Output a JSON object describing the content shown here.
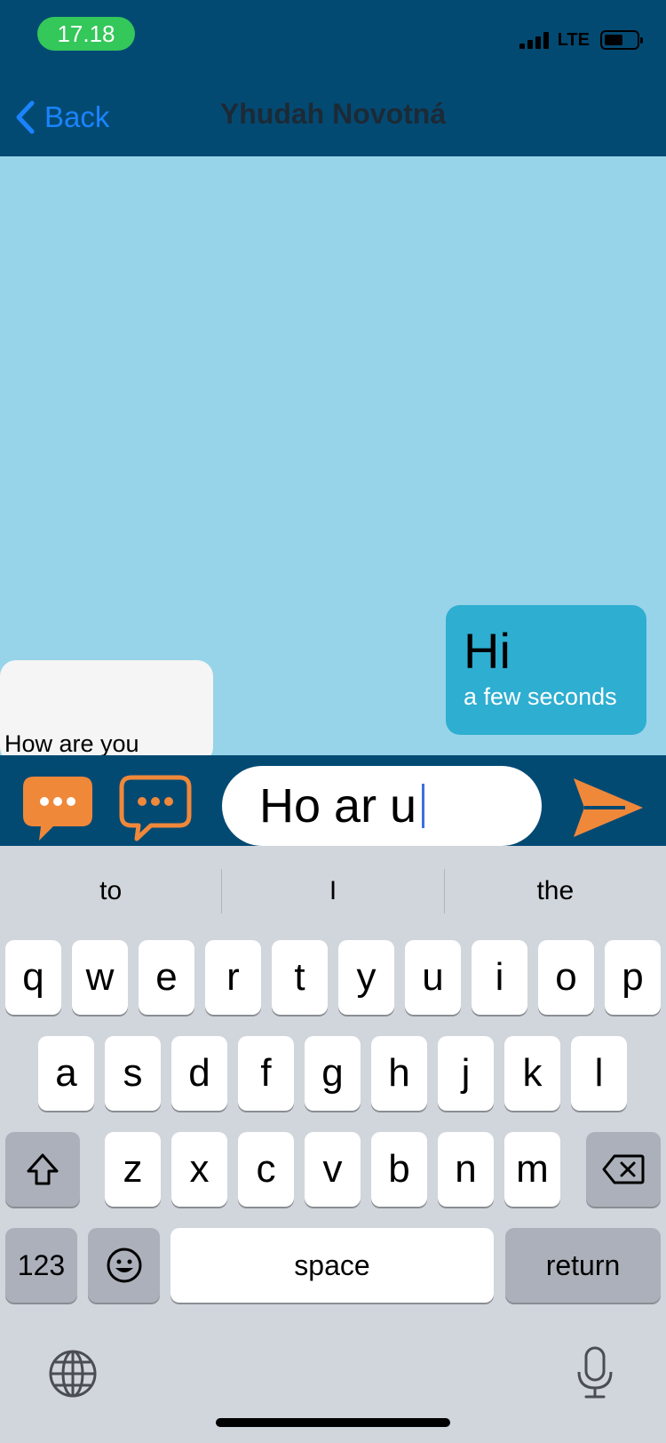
{
  "status_bar": {
    "time": "17.18",
    "network": "LTE"
  },
  "nav": {
    "back_label": "Back",
    "title": "Yhudah Novotná"
  },
  "messages": [
    {
      "direction": "outgoing",
      "text": "Hi",
      "timestamp": "a few seconds"
    },
    {
      "direction": "incoming",
      "text": "How are you"
    }
  ],
  "composer": {
    "input_value": "Ho ar u",
    "icons": [
      "chat-bubble-filled-icon",
      "chat-bubble-outline-icon",
      "send-icon"
    ]
  },
  "keyboard": {
    "suggestions": [
      "to",
      "I",
      "the"
    ],
    "row1": [
      "q",
      "w",
      "e",
      "r",
      "t",
      "y",
      "u",
      "i",
      "o",
      "p"
    ],
    "row2": [
      "a",
      "s",
      "d",
      "f",
      "g",
      "h",
      "j",
      "k",
      "l"
    ],
    "row3": [
      "z",
      "x",
      "c",
      "v",
      "b",
      "n",
      "m"
    ],
    "numbers_label": "123",
    "space_label": "space",
    "return_label": "return"
  },
  "colors": {
    "nav_bar": "#034a73",
    "chat_bg": "#97d4e9",
    "bubble_out": "#2eaed1",
    "accent": "#f0883a",
    "link": "#1a84ff"
  }
}
